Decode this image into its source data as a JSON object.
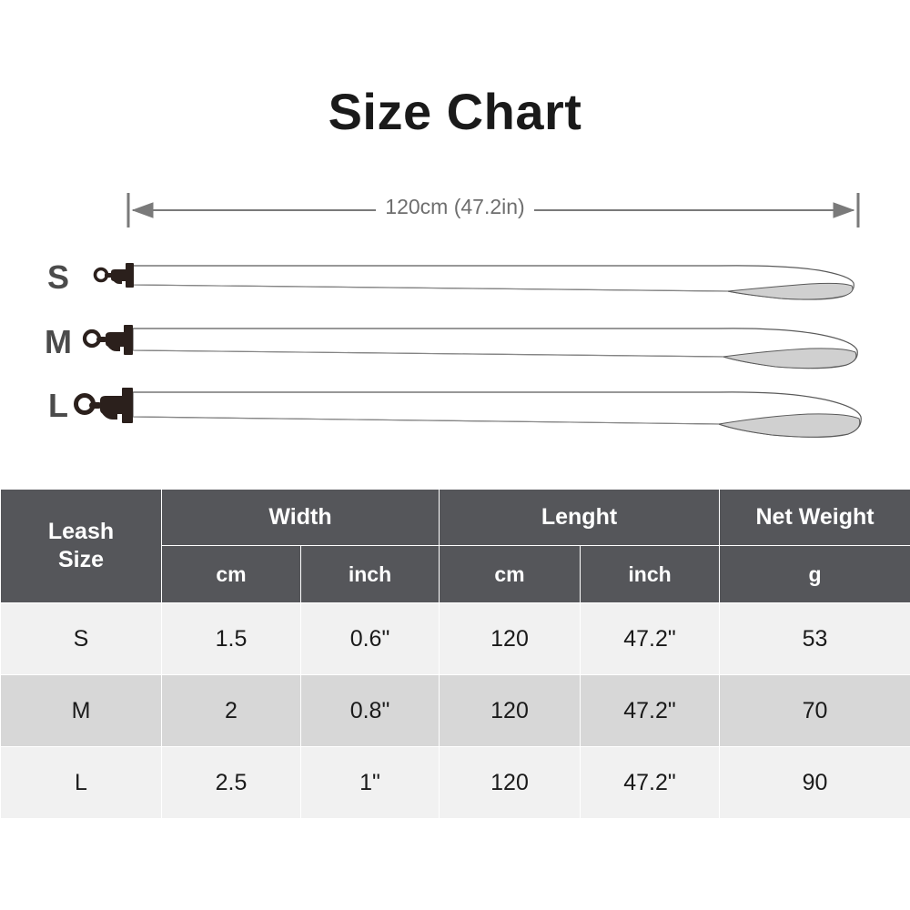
{
  "title": "Size Chart",
  "diagram": {
    "dimension_label": "120cm (47.2in)",
    "size_labels": [
      {
        "key": "s",
        "label": "S"
      },
      {
        "key": "m",
        "label": "M"
      },
      {
        "key": "l",
        "label": "L"
      }
    ],
    "colors": {
      "dimension_line": "#7a7a7a",
      "strap_outline": "#555555",
      "handle_fill": "#d0d0d0",
      "clip_fill": "#2b201c",
      "label_text": "#4b4b4b"
    }
  },
  "table": {
    "header": {
      "leash_size": {
        "line1": "Leash",
        "line2": "Size"
      },
      "width": "Width",
      "length": "Lenght",
      "net_weight": "Net Weight",
      "width_cm": "cm",
      "width_inch": "inch",
      "length_cm": "cm",
      "length_inch": "inch",
      "weight_g": "g"
    },
    "colors": {
      "header_bg": "#55565a",
      "header_text": "#ffffff",
      "row_odd_bg": "#f1f1f1",
      "row_even_bg": "#d7d7d7",
      "grid": "#ffffff"
    },
    "rows": [
      {
        "size": "S",
        "width_cm": "1.5",
        "width_inch": "0.6\"",
        "length_cm": "120",
        "length_inch": "47.2\"",
        "weight_g": "53"
      },
      {
        "size": "M",
        "width_cm": "2",
        "width_inch": "0.8\"",
        "length_cm": "120",
        "length_inch": "47.2\"",
        "weight_g": "70"
      },
      {
        "size": "L",
        "width_cm": "2.5",
        "width_inch": "1\"",
        "length_cm": "120",
        "length_inch": "47.2\"",
        "weight_g": "90"
      }
    ]
  },
  "chart_data": {
    "type": "table",
    "title": "Size Chart",
    "categories": [
      "S",
      "M",
      "L"
    ],
    "columns": [
      "Leash Size",
      "Width cm",
      "Width inch",
      "Lenght cm",
      "Lenght inch",
      "Net Weight g"
    ],
    "series": [
      {
        "name": "Width cm",
        "values": [
          1.5,
          2,
          2.5
        ]
      },
      {
        "name": "Width inch",
        "values": [
          0.6,
          0.8,
          1
        ]
      },
      {
        "name": "Lenght cm",
        "values": [
          120,
          120,
          120
        ]
      },
      {
        "name": "Lenght inch",
        "values": [
          47.2,
          47.2,
          47.2
        ]
      },
      {
        "name": "Net Weight g",
        "values": [
          53,
          70,
          90
        ]
      }
    ],
    "annotations": [
      "120cm (47.2in)"
    ]
  }
}
